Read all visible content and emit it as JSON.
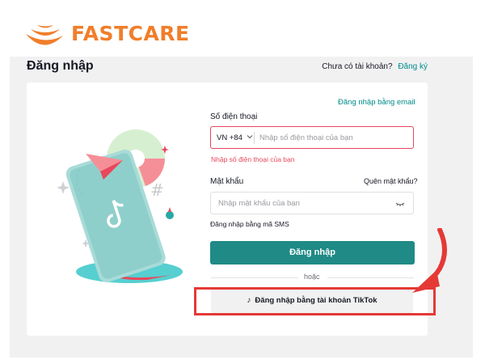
{
  "brand": {
    "name": "FASTCARE",
    "color": "#f07e2b"
  },
  "page": {
    "title": "Đăng nhập",
    "signup_prompt": "Chưa có tài khoản?",
    "signup_link": "Đăng ký"
  },
  "form": {
    "email_login_link": "Đăng nhập bằng email",
    "phone_label": "Số điện thoại",
    "country_code": "VN +84",
    "phone_placeholder": "Nhập số điện thoại của bạn",
    "phone_error": "Nhập số điện thoại của bạn",
    "password_label": "Mật khẩu",
    "forgot_password": "Quên mật khẩu?",
    "password_placeholder": "Nhập mật khẩu của bạn",
    "sms_login": "Đăng nhập bằng mã SMS",
    "login_button": "Đăng nhập",
    "or_text": "hoặc",
    "tiktok_button": "Đăng nhập bằng tài khoản TikTok"
  },
  "icons": {
    "chevron": "chevron-down-icon",
    "eye": "eye-closed-icon",
    "tiktok": "tiktok-icon"
  },
  "colors": {
    "accent": "#1f8a86",
    "link": "#008a8a",
    "error": "#e8475c",
    "annotation": "#e53935"
  }
}
